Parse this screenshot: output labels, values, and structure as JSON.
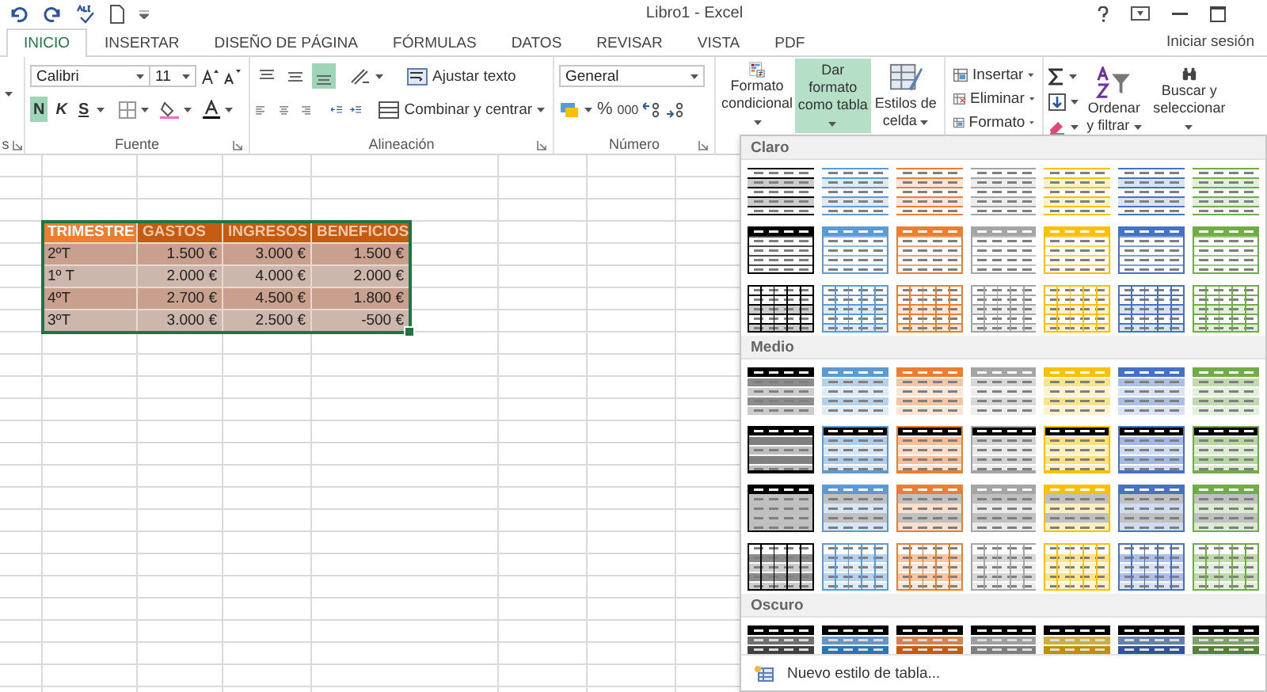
{
  "window": {
    "title": "Libro1 - Excel"
  },
  "tabs": [
    {
      "label": "INICIO",
      "selected": true
    },
    {
      "label": "INSERTAR",
      "selected": false
    },
    {
      "label": "DISEÑO DE PÁGINA",
      "selected": false
    },
    {
      "label": "FÓRMULAS",
      "selected": false
    },
    {
      "label": "DATOS",
      "selected": false
    },
    {
      "label": "REVISAR",
      "selected": false
    },
    {
      "label": "VISTA",
      "selected": false
    },
    {
      "label": "PDF",
      "selected": false
    }
  ],
  "account": {
    "label": "Iniciar sesión"
  },
  "ribbon": {
    "clipboard": {
      "label": "s"
    },
    "font": {
      "label": "Fuente",
      "family": "Calibri",
      "size": "11",
      "bold": {
        "label": "N",
        "on": true
      },
      "italic": {
        "label": "K",
        "on": false
      },
      "underline": {
        "label": "S",
        "on": false
      }
    },
    "alignment": {
      "label": "Alineación",
      "vertical": [
        {
          "selected": false
        },
        {
          "selected": false
        },
        {
          "selected": true
        }
      ],
      "wrap": "Ajustar texto",
      "merge": "Combinar y centrar"
    },
    "number": {
      "label": "Número",
      "format": "General",
      "percent": "%",
      "thousands": "000"
    },
    "styles": [
      {
        "label": "Formato condicional",
        "selected": false
      },
      {
        "label": "Dar formato como tabla",
        "selected": true
      },
      {
        "label": "Estilos de celda",
        "selected": false
      }
    ],
    "cells": [
      "Insertar",
      "Eliminar",
      "Formato"
    ],
    "editing": [
      {
        "label": "Ordenar y filtrar"
      },
      {
        "label": "Buscar y seleccionar"
      }
    ]
  },
  "sheet": {
    "table": {
      "columns": [
        {
          "label": "TRIMESTRE",
          "selected": true
        },
        {
          "label": "GASTOS",
          "selected": false
        },
        {
          "label": "INGRESOS",
          "selected": false
        },
        {
          "label": "BENEFICIOS",
          "selected": false
        }
      ],
      "rows": [
        [
          "2ºT",
          "1.500 €",
          "3.000 €",
          "1.500 €"
        ],
        [
          "1º T",
          "2.000 €",
          "4.000 €",
          "2.000 €"
        ],
        [
          "4ºT",
          "2.700 €",
          "4.500 €",
          "1.800 €"
        ],
        [
          "3ºT",
          "3.000 €",
          "2.500 €",
          "-500 €"
        ]
      ]
    }
  },
  "gallery": {
    "sections": [
      {
        "title": "Claro",
        "rows": [
          {
            "kind": "lines",
            "styles": [
              {
                "color": "#000000"
              },
              {
                "color": "#5b9bd5"
              },
              {
                "color": "#ed7d31"
              },
              {
                "color": "#a5a5a5"
              },
              {
                "color": "#ffc000"
              },
              {
                "color": "#4472c4"
              },
              {
                "color": "#70ad47"
              }
            ]
          },
          {
            "kind": "header",
            "styles": [
              {
                "color": "#000000"
              },
              {
                "color": "#5b9bd5"
              },
              {
                "color": "#ed7d31"
              },
              {
                "color": "#a5a5a5"
              },
              {
                "color": "#ffc000"
              },
              {
                "color": "#4472c4"
              },
              {
                "color": "#70ad47"
              }
            ]
          },
          {
            "kind": "grid",
            "styles": [
              {
                "color": "#000000"
              },
              {
                "color": "#5b9bd5"
              },
              {
                "color": "#ed7d31"
              },
              {
                "color": "#a5a5a5"
              },
              {
                "color": "#ffc000"
              },
              {
                "color": "#4472c4"
              },
              {
                "color": "#70ad47"
              }
            ]
          }
        ]
      },
      {
        "title": "Medio",
        "rows": [
          {
            "kind": "medium-header",
            "styles": [
              {
                "color": "#000000"
              },
              {
                "color": "#5b9bd5"
              },
              {
                "color": "#ed7d31"
              },
              {
                "color": "#a5a5a5"
              },
              {
                "color": "#ffc000"
              },
              {
                "color": "#4472c4"
              },
              {
                "color": "#70ad47"
              }
            ]
          },
          {
            "kind": "medium-black-header",
            "styles": [
              {
                "color": "#000000"
              },
              {
                "color": "#5b9bd5"
              },
              {
                "color": "#ed7d31"
              },
              {
                "color": "#a5a5a5"
              },
              {
                "color": "#ffc000"
              },
              {
                "color": "#4472c4"
              },
              {
                "color": "#70ad47"
              }
            ]
          },
          {
            "kind": "medium-banded",
            "styles": [
              {
                "color": "#000000"
              },
              {
                "color": "#5b9bd5"
              },
              {
                "color": "#ed7d31"
              },
              {
                "color": "#a5a5a5"
              },
              {
                "color": "#ffc000"
              },
              {
                "color": "#4472c4"
              },
              {
                "color": "#70ad47"
              }
            ]
          },
          {
            "kind": "medium-grid",
            "styles": [
              {
                "color": "#000000"
              },
              {
                "color": "#5b9bd5"
              },
              {
                "color": "#ed7d31"
              },
              {
                "color": "#a5a5a5"
              },
              {
                "color": "#ffc000"
              },
              {
                "color": "#4472c4"
              },
              {
                "color": "#70ad47"
              }
            ]
          }
        ]
      },
      {
        "title": "Oscuro",
        "rows": [
          {
            "kind": "dark",
            "styles": [
              {
                "color": "#404040"
              },
              {
                "color": "#2e75b6"
              },
              {
                "color": "#c55a11"
              },
              {
                "color": "#7f7f7f"
              },
              {
                "color": "#bf9000"
              },
              {
                "color": "#2f5597"
              },
              {
                "color": "#548235"
              }
            ]
          }
        ]
      }
    ],
    "actions": [
      "Nuevo estilo de tabla..."
    ]
  }
}
